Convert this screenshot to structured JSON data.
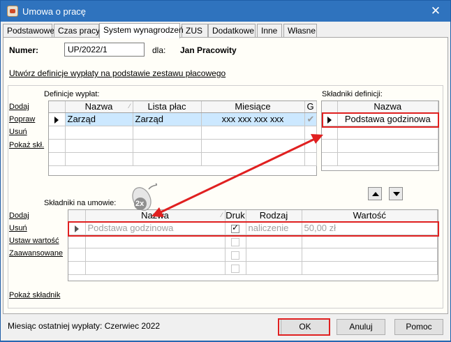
{
  "window": {
    "title": "Umowa o pracę"
  },
  "tabs": [
    "Podstawowe",
    "Czas pracy",
    "System wynagrodzeń",
    "ZUS",
    "Dodatkowe",
    "Inne",
    "Własne"
  ],
  "header": {
    "numer_label": "Numer:",
    "numer_value": "UP/2022/1",
    "dla_label": "dla:",
    "dla_value": "Jan Pracowity"
  },
  "create_link": "Utwórz definicje wypłaty na podstawie zestawu płacowego",
  "definitions": {
    "label": "Definicje wypłat:",
    "actions": [
      "Dodaj",
      "Popraw",
      "Usuń",
      "Pokaż skł."
    ],
    "columns": [
      "Nazwa",
      "Lista płac",
      "Miesiące",
      "G"
    ],
    "rows": [
      {
        "nazwa": "Zarząd",
        "lista": "Zarząd",
        "miesiace": "xxx xxx xxx xxx",
        "g": "✔"
      }
    ]
  },
  "def_components": {
    "label": "Składniki definicji:",
    "column": "Nazwa",
    "rows": [
      "Podstawa godzinowa"
    ]
  },
  "contract_components": {
    "label": "Składniki na umowie:",
    "actions": [
      "Dodaj",
      "Usuń",
      "Ustaw wartość",
      "Zaawansowane"
    ],
    "columns": [
      "Nazwa",
      "Druk",
      "Rodzaj",
      "Wartość"
    ],
    "rows": [
      {
        "nazwa": "Podstawa godzinowa",
        "druk": true,
        "rodzaj": "naliczenie",
        "wartosc": "50,00 zł"
      }
    ],
    "show_link": "Pokaż składnik"
  },
  "overlay": {
    "mouse_badge": "2x"
  },
  "status": {
    "text": "Miesiąc ostatniej wypłaty: Czerwiec 2022"
  },
  "buttons": {
    "ok": "OK",
    "cancel": "Anuluj",
    "help": "Pomoc"
  },
  "colors": {
    "titlebar": "#2f73be",
    "highlight": "#e02020",
    "selection": "#cce8ff"
  },
  "icons": [
    "app-icon",
    "close-icon",
    "row-indicator-icon",
    "move-up-icon",
    "move-down-icon",
    "mouse-double-click-icon"
  ]
}
